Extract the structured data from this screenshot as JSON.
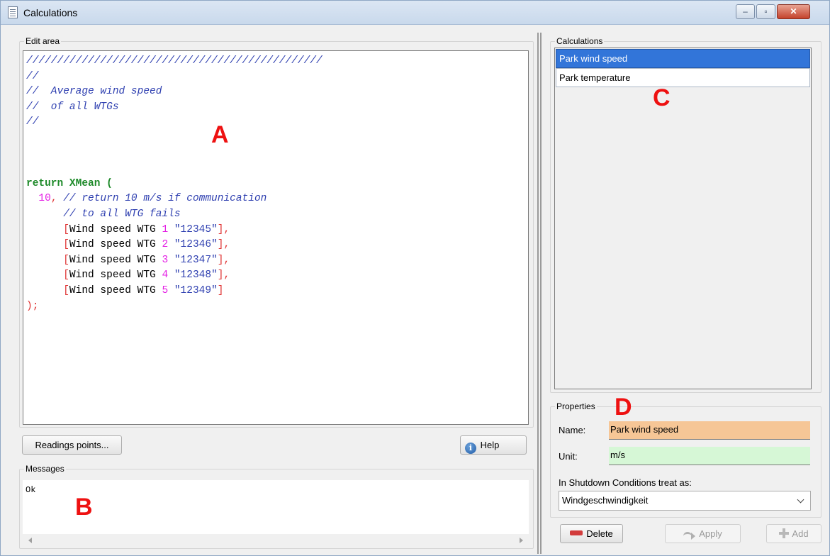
{
  "window": {
    "title": "Calculations",
    "minimize": "–",
    "maximize": "▫",
    "close": "✕"
  },
  "edit_area": {
    "label": "Edit area",
    "code": {
      "l1": "////////////////////////////////////////////////",
      "l2": "//",
      "l3": "//  Average wind speed",
      "l4": "//  of all WTGs",
      "l5": "//",
      "l9_kw": "return XMean",
      "l9_br": " (",
      "l10_num": "  10",
      "l10_br": ",",
      "l10_com": " // return 10 m/s if communication",
      "l11_com": "      // to all WTG fails",
      "rows": [
        {
          "pre": "      ",
          "open": "[",
          "name": "Wind speed WTG ",
          "num": "1",
          "str": " \"12345\"",
          "close": "]",
          "tail": ","
        },
        {
          "pre": "      ",
          "open": "[",
          "name": "Wind speed WTG ",
          "num": "2",
          "str": " \"12346\"",
          "close": "]",
          "tail": ","
        },
        {
          "pre": "      ",
          "open": "[",
          "name": "Wind speed WTG ",
          "num": "3",
          "str": " \"12347\"",
          "close": "]",
          "tail": ","
        },
        {
          "pre": "      ",
          "open": "[",
          "name": "Wind speed WTG ",
          "num": "4",
          "str": " \"12348\"",
          "close": "]",
          "tail": ","
        },
        {
          "pre": "      ",
          "open": "[",
          "name": "Wind speed WTG ",
          "num": "5",
          "str": " \"12349\"",
          "close": "]",
          "tail": ""
        }
      ],
      "end": ");"
    }
  },
  "buttons": {
    "readings": "Readings points...",
    "help": "Help",
    "delete": "Delete",
    "apply": "Apply",
    "add": "Add"
  },
  "messages": {
    "label": "Messages",
    "text": "Ok"
  },
  "calculations": {
    "label": "Calculations",
    "items": [
      {
        "label": "Park wind speed",
        "selected": true
      },
      {
        "label": "Park temperature",
        "selected": false
      }
    ]
  },
  "properties": {
    "label": "Properties",
    "name_label": "Name:",
    "name_value": "Park wind speed",
    "unit_label": "Unit:",
    "unit_value": "m/s",
    "shutdown_label": "In Shutdown Conditions treat as:",
    "shutdown_value": "Windgeschwindigkeit"
  },
  "markers": {
    "a": "A",
    "b": "B",
    "c": "C",
    "d": "D"
  },
  "colors": {
    "comment": "#2e3fb0",
    "keyword": "#1e8a2a",
    "number": "#e41fe4",
    "bracket": "#e03232",
    "selection": "#3275d9",
    "name_field": "#f6c696",
    "unit_field": "#d6f7d6",
    "annotation": "#ee1111"
  }
}
